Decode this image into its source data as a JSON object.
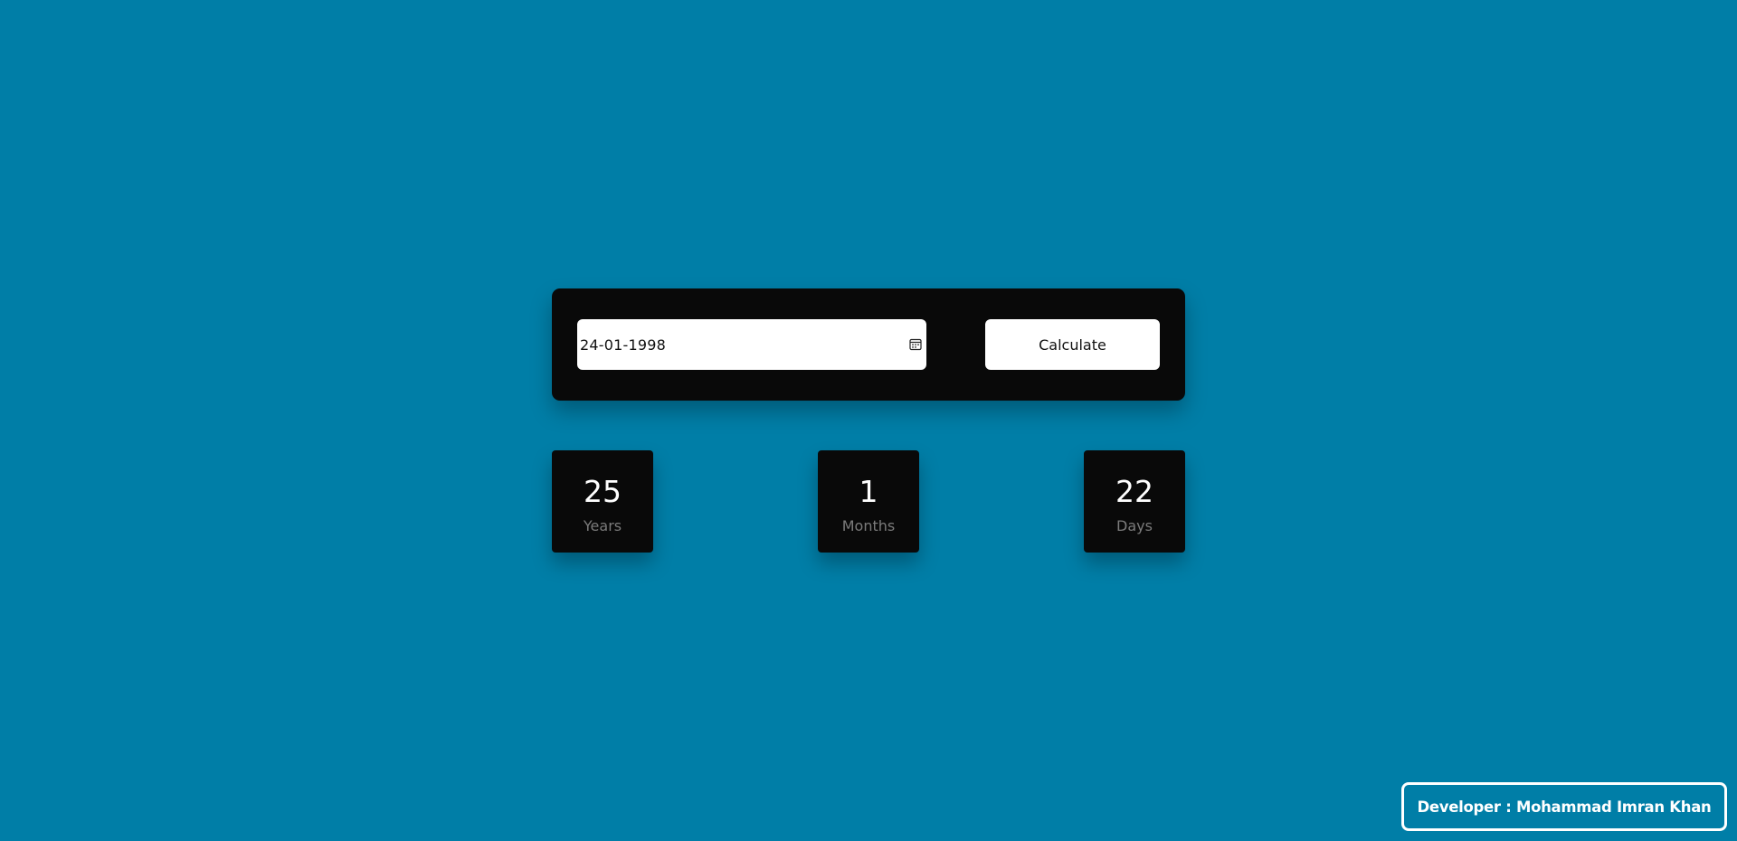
{
  "input": {
    "date_value": "24-01-1998",
    "icon": "calendar-icon"
  },
  "button": {
    "calculate_label": "Calculate"
  },
  "results": {
    "years": {
      "value": "25",
      "label": "Years"
    },
    "months": {
      "value": "1",
      "label": "Months"
    },
    "days": {
      "value": "22",
      "label": "Days"
    }
  },
  "footer": {
    "credit": "Developer : Mohammad Imran Khan"
  },
  "colors": {
    "background": "#007ea7",
    "panel": "#090909",
    "label_muted": "#7b7b7b"
  }
}
